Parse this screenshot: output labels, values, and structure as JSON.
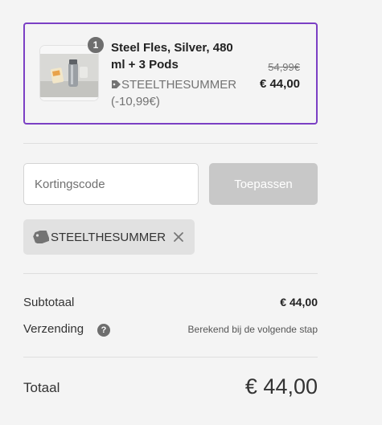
{
  "cart": {
    "item": {
      "quantity": "1",
      "name": "Steel Fles, Silver, 480 ml + 3 Pods",
      "discount_text": "STEELTHESUMMER (-10,99€)",
      "original_price": "54,99€",
      "price": "€ 44,00",
      "thumbnail_icon": "product-bottle-image"
    }
  },
  "discount": {
    "placeholder": "Kortingscode",
    "apply_label": "Toepassen",
    "applied_code": "STEELTHESUMMER",
    "tag_icon": "tag-icon",
    "remove_icon": "close-icon"
  },
  "summary": {
    "subtotal_label": "Subtotaal",
    "subtotal_value": "€ 44,00",
    "shipping_label": "Verzending",
    "shipping_help_icon": "?",
    "shipping_value": "Berekend bij de volgende stap",
    "total_label": "Totaal",
    "total_value": "€ 44,00"
  },
  "colors": {
    "card_border": "#7b3fc4",
    "apply_button": "#c8c8c8",
    "chip_background": "#e1e1e1"
  }
}
